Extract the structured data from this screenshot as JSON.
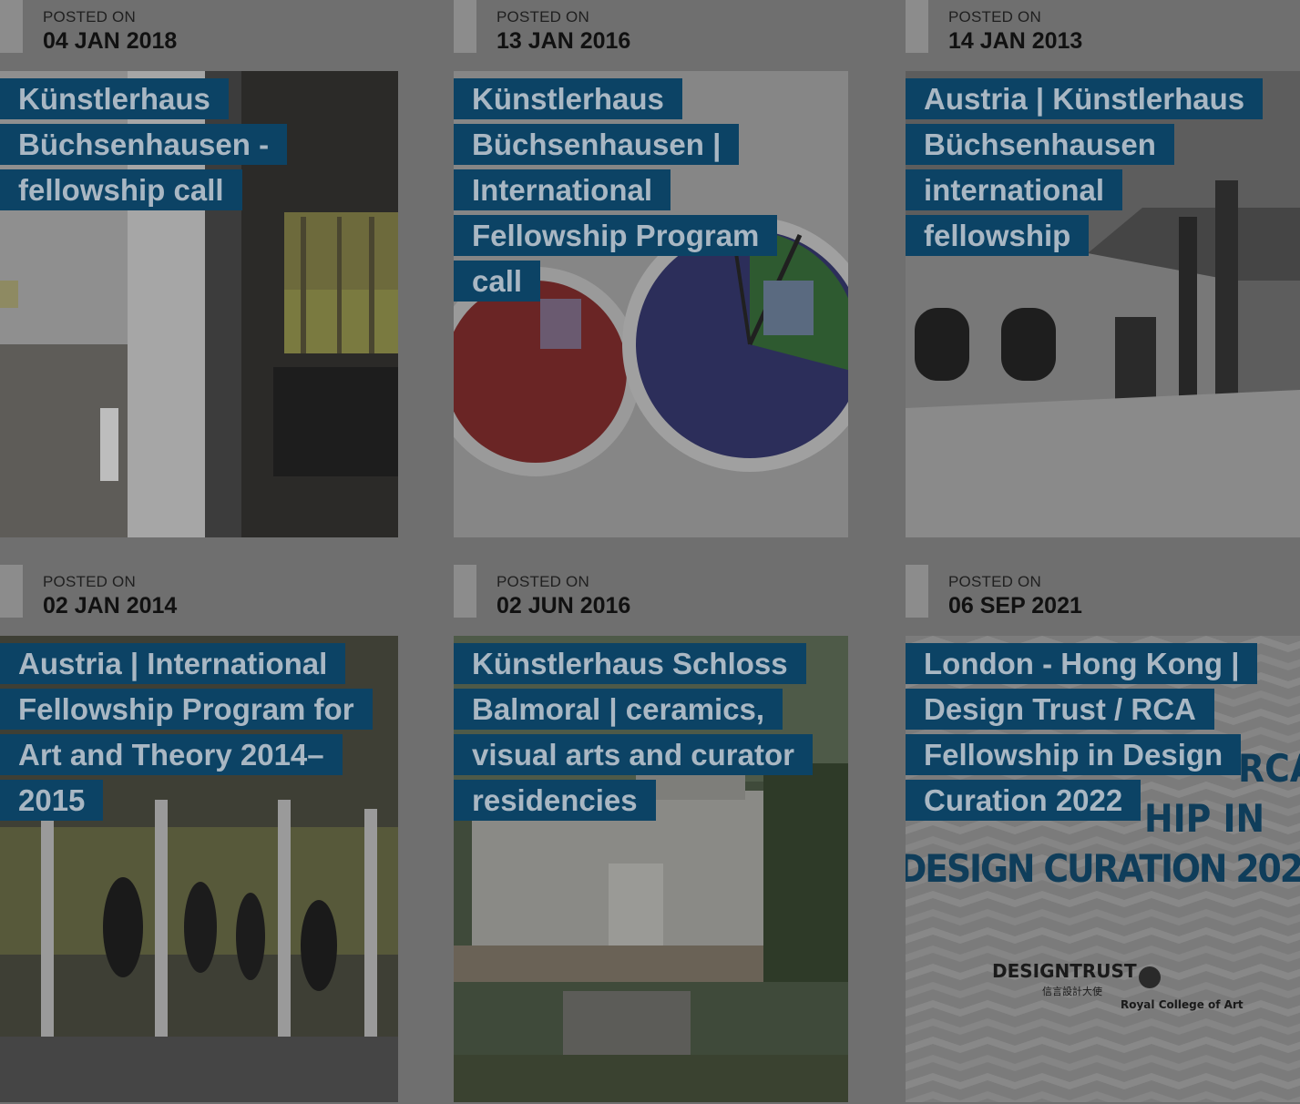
{
  "posted_on_label": "POSTED ON",
  "cards": [
    {
      "date": "04 JAN 2018",
      "title": "Künstlerhaus Büchsenhausen - fellowship call"
    },
    {
      "date": "13 JAN 2016",
      "title": "Künstlerhaus Büchsenhausen | International Fellowship Program call"
    },
    {
      "date": "14 JAN 2013",
      "title": "Austria | Künstlerhaus Büchsenhausen international fellowship"
    },
    {
      "date": "02 JAN 2014",
      "title": "Austria | International Fellowship Program for Art and Theory 2014–2015"
    },
    {
      "date": "02 JUN 2016",
      "title": "Künstlerhaus Schloss Balmoral | ceramics, visual arts and curator residencies"
    },
    {
      "date": "06 SEP 2021",
      "title": "London - Hong Kong | Design Trust / RCA Fellowship in Design Curation 2022"
    }
  ],
  "card6_image": {
    "line1": "RCA",
    "line2": "HIP IN",
    "line3": "DESIGN CURATION 202",
    "logo1": "DESIGNTRUST",
    "logo1_sub": "信言設計大使",
    "logo2": "Royal College of Art"
  }
}
